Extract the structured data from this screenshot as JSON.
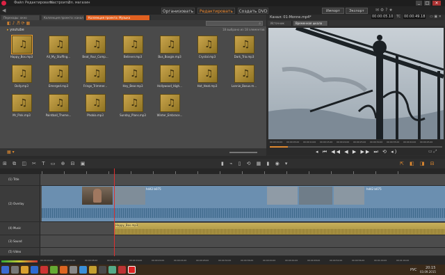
{
  "menu": {
    "items": [
      "Файл",
      "Редактировать",
      "Настроить",
      "Эл. магазин"
    ]
  },
  "modes": {
    "organize": "Организовать",
    "edit": "Редактировать",
    "dvd": "Создать DVD"
  },
  "top_buttons": {
    "import": "Импорт",
    "export": "Экспорт"
  },
  "library": {
    "tabs": [
      "Переходы: окно",
      "Коллекция проекта: канал",
      "Коллекция проекта: Музыка"
    ],
    "path": "youtube",
    "selected_info": "18 выбрано из 18 элементов",
    "tiles": [
      "Happy_Bos.mp3",
      "All_My_Stuffing...",
      "Beat_Your_Comp...",
      "Believer.mp3",
      "Bus_Boogie.mp3",
      "Crystal.mp3",
      "Dark_Trio.mp3",
      "Dolly.mp3",
      "Emerged.mp3",
      "Fringe_Trimmer...",
      "Hey_Bear.mp3",
      "Hollywood_High...",
      "Hot_Heat.mp3",
      "Lonnie_Basus.m...",
      "Mr_Pink.mp3",
      "Paintball_Theme...",
      "Phobia.mp3",
      "Sunday_Plans.mp3",
      "Winter_Embrace..."
    ]
  },
  "preview": {
    "title": "Канал: 01-Monne.mp4*",
    "tabs": [
      "Источник",
      "Временная шкала"
    ],
    "timecode": "00:00:05.10",
    "tc_label": "TC",
    "duration": "00:00:49.18",
    "ruler_labels": [
      "00:00:00.00",
      "00:00:05.00",
      "00:00:10.00",
      "00:00:15.00",
      "00:00:20.00",
      "00:00:25.00",
      "00:00:30.00",
      "00:00:35.00",
      "00:00:40.00",
      "00:00:45.00"
    ]
  },
  "timeline": {
    "tracks": [
      "(1) Title",
      "(2) Overlay",
      "(4) Music",
      "(3) Sound",
      "(5) Video"
    ],
    "clip_labels": {
      "overlay1": "hd42 b075",
      "overlay2": "hd42 b075",
      "music": "Happy_Bos.mp3"
    },
    "ruler": [
      "00:00:00.00",
      "00:00:04.00",
      "00:00:08.00",
      "00:00:12.00",
      "00:00:16.00",
      "00:00:20.00",
      "00:00:24.00",
      "00:00:28.00",
      "00:00:32.00",
      "00:00:36.00",
      "00:00:40.00",
      "00:00:44.00",
      "00:00:48.00",
      "00:00:52.00",
      "00:00:56.00",
      "00:01:00.00",
      "00:01:04.00",
      "00:01:08.00",
      "00:01:12.00"
    ]
  },
  "taskbar": {
    "lang": "РУС",
    "time": "20:15",
    "date": "03.09.2015"
  }
}
